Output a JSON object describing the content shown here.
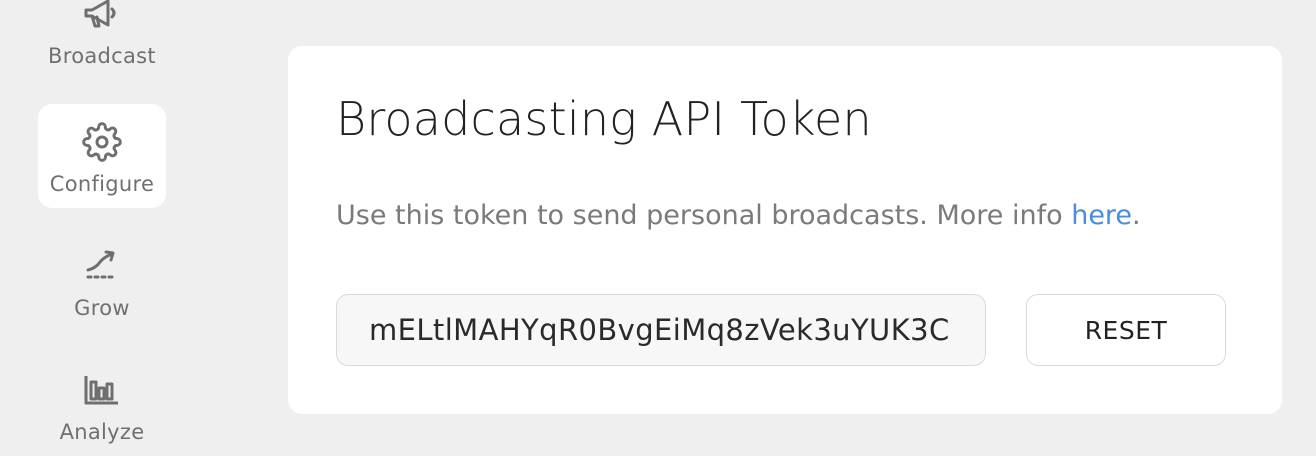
{
  "sidebar": {
    "items": [
      {
        "label": "Broadcast",
        "icon": "megaphone-icon",
        "active": false
      },
      {
        "label": "Configure",
        "icon": "gear-icon",
        "active": true
      },
      {
        "label": "Grow",
        "icon": "growth-arrow-icon",
        "active": false
      },
      {
        "label": "Analyze",
        "icon": "bar-chart-icon",
        "active": false
      }
    ]
  },
  "card": {
    "title": "Broadcasting API Token",
    "description_prefix": "Use this token to send personal broadcasts. More info ",
    "link_text": "here",
    "description_suffix": ".",
    "token_value": "mELtlMAHYqR0BvgEiMq8zVek3uYUK3C",
    "reset_label": "RESET"
  },
  "colors": {
    "background": "#efefef",
    "card": "#ffffff",
    "link": "#4a8de0",
    "muted_text": "#7a7a7a",
    "icon": "#6f6f6f"
  }
}
